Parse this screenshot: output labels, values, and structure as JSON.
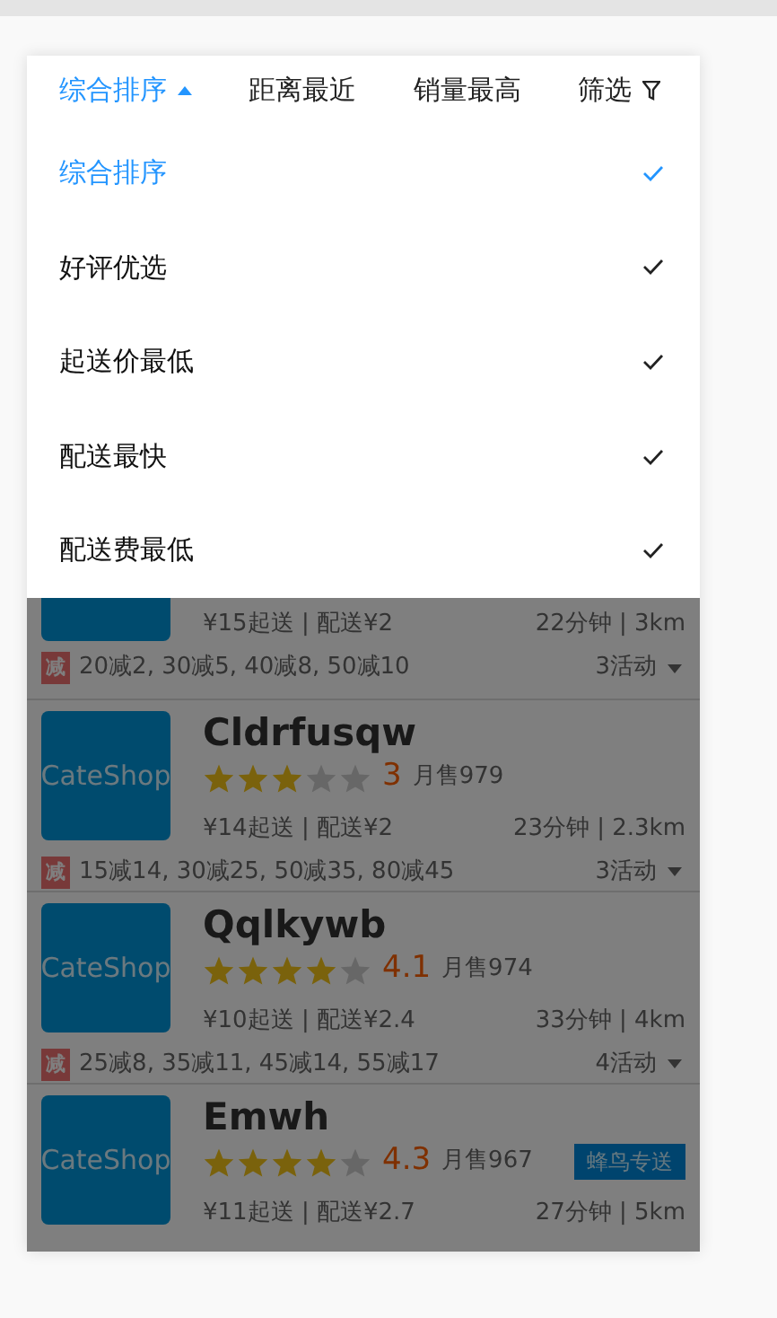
{
  "sort_tabs": [
    {
      "label": "综合排序",
      "selected": true,
      "kind": "sort"
    },
    {
      "label": "距离最近",
      "selected": false,
      "kind": "plain"
    },
    {
      "label": "销量最高",
      "selected": false,
      "kind": "plain"
    },
    {
      "label": "筛选",
      "selected": false,
      "kind": "filter"
    }
  ],
  "sort_menu": [
    {
      "label": "综合排序",
      "selected": true
    },
    {
      "label": "好评优选",
      "selected": false
    },
    {
      "label": "起送价最低",
      "selected": false
    },
    {
      "label": "配送最快",
      "selected": false
    },
    {
      "label": "配送费最低",
      "selected": false
    }
  ],
  "shops": [
    {
      "kind": "partial",
      "min_order": "¥15起送 | 配送¥2",
      "delivery": "22分钟 | 3km",
      "promo_tag": "减",
      "promo": "20减2, 30减5, 40减8, 50减10",
      "activities": "3活动"
    },
    {
      "kind": "full",
      "logo": "CateShop",
      "name": "Cldrfusqw",
      "stars": 3,
      "rating": "3",
      "monthly_sales": "月售979",
      "min_order": "¥14起送 | 配送¥2",
      "delivery": "23分钟 | 2.3km",
      "promo_tag": "减",
      "promo": "15减14, 30减25, 50减35, 80减45",
      "activities": "3活动"
    },
    {
      "kind": "full",
      "logo": "CateShop",
      "name": "Qqlkywb",
      "stars": 4,
      "rating": "4.1",
      "monthly_sales": "月售974",
      "min_order": "¥10起送 | 配送¥2.4",
      "delivery": "33分钟 | 4km",
      "promo_tag": "减",
      "promo": "25减8, 35减11, 45减14, 55减17",
      "activities": "4活动"
    },
    {
      "kind": "full",
      "logo": "CateShop",
      "name": "Emwh",
      "stars": 4,
      "rating": "4.3",
      "monthly_sales": "月售967",
      "badge": "蜂鸟专送",
      "min_order": "¥11起送 | 配送¥2.7",
      "delivery": "27分钟 | 5km"
    }
  ]
}
